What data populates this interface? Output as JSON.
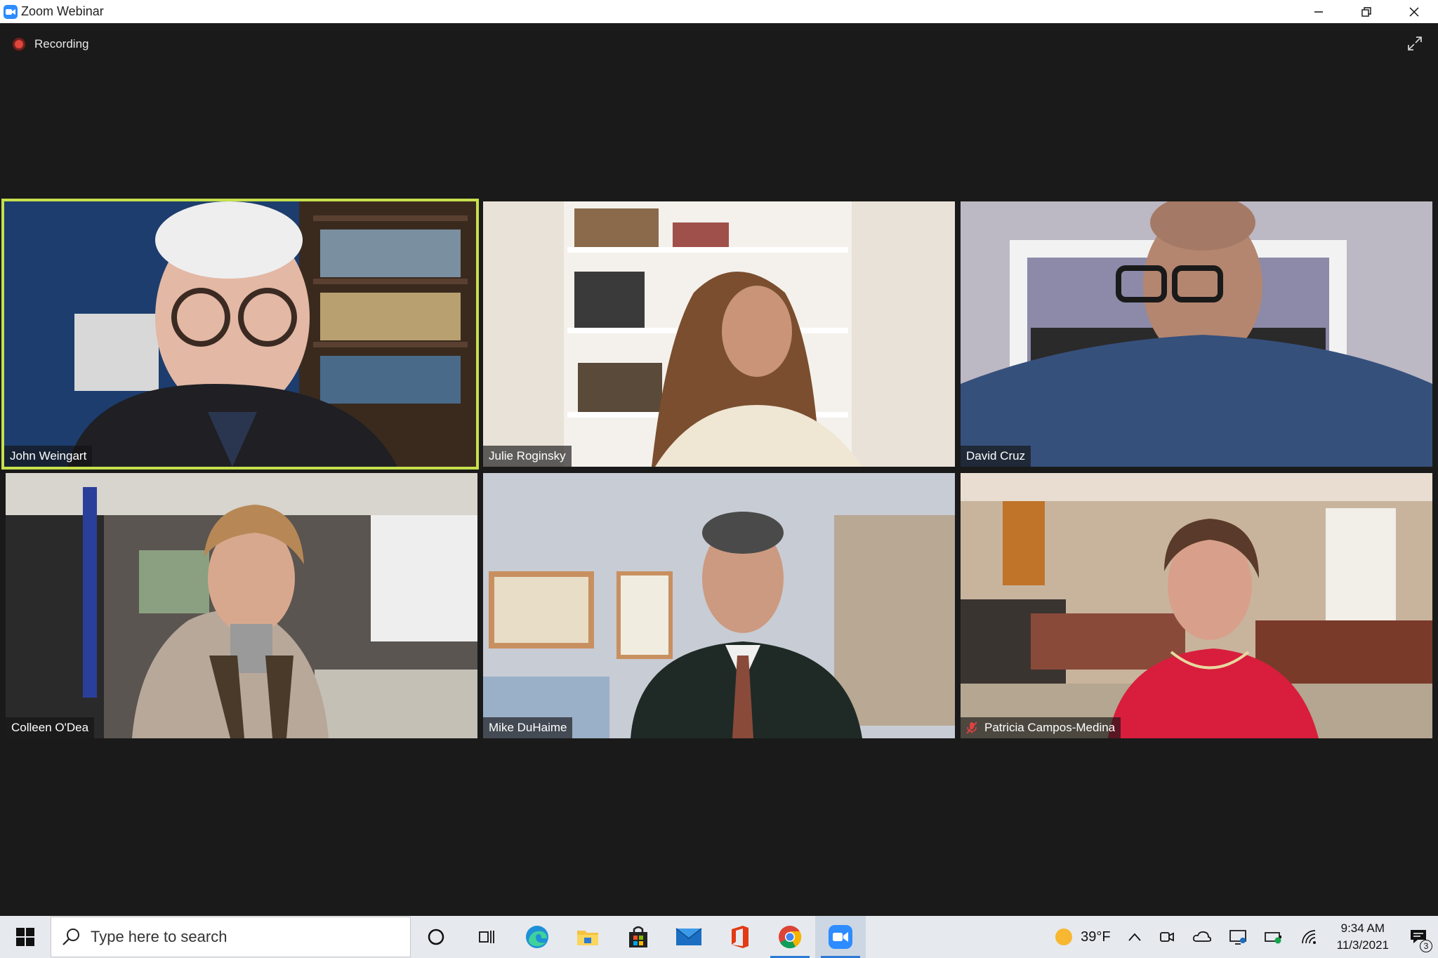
{
  "window": {
    "title": "Zoom Webinar"
  },
  "meeting": {
    "recording_label": "Recording",
    "participants": [
      {
        "name": "John Weingart",
        "muted": false,
        "active_speaker": true
      },
      {
        "name": "Julie Roginsky",
        "muted": false,
        "active_speaker": false
      },
      {
        "name": "David Cruz",
        "muted": false,
        "active_speaker": false
      },
      {
        "name": "Colleen O'Dea",
        "muted": false,
        "active_speaker": false
      },
      {
        "name": "Mike DuHaime",
        "muted": false,
        "active_speaker": false
      },
      {
        "name": "Patricia Campos-Medina",
        "muted": true,
        "active_speaker": false
      }
    ]
  },
  "taskbar": {
    "search_placeholder": "Type here to search",
    "weather": "39°F",
    "time": "9:34 AM",
    "date": "11/3/2021",
    "notification_count": "3"
  },
  "colors": {
    "active_speaker_border": "#c6e04c",
    "zoom_blue": "#2d8cff",
    "recording_red": "#e0453b"
  }
}
